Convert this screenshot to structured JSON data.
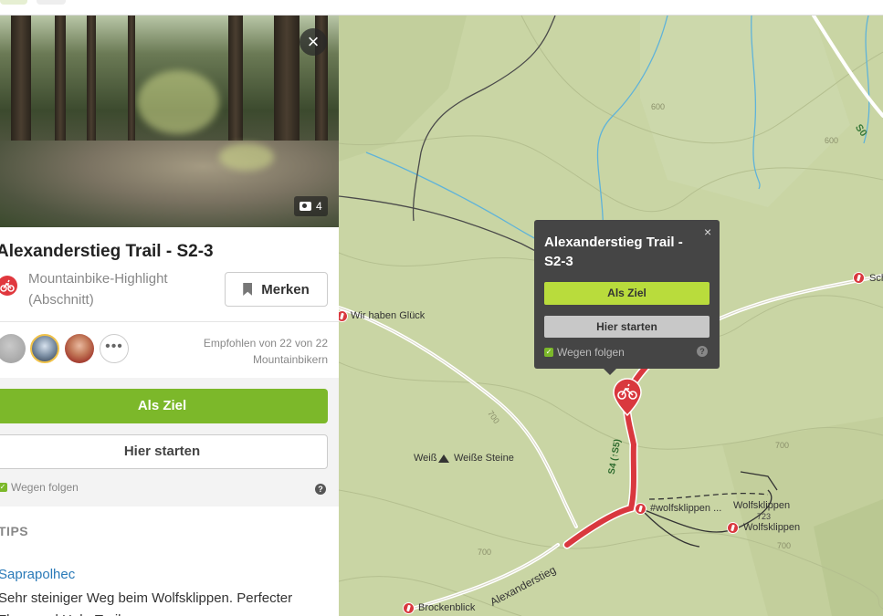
{
  "panel": {
    "photo_count": "4",
    "title": "Alexanderstieg Trail - S2-3",
    "subtitle": "Mountainbike-Highlight (Abschnitt)",
    "merken_label": "Merken",
    "recommended": "Empfohlen von 22 von 22 Mountainbikern",
    "more_label": "•••",
    "ziel_label": "Als Ziel",
    "start_label": "Hier starten",
    "follow_label": "Wegen folgen",
    "help_label": "?",
    "close_label": "×",
    "tips_heading": "TIPS",
    "tip": {
      "author": "Saprapolhec",
      "text": "Sehr steiniger Weg beim Wolfsklippen. Perfecter Flow- und Hole-Trail."
    }
  },
  "popup": {
    "title": "Alexanderstieg Trail - S2-3",
    "close_label": "×",
    "ziel_label": "Als Ziel",
    "start_label": "Hier starten",
    "follow_label": "Wegen folgen",
    "help_label": "?"
  },
  "map": {
    "labels": {
      "wir_haben_glueck": "Wir haben Glück",
      "weisse_steine_1": "Weiß",
      "weisse_steine_2": "Weiße Steine",
      "wolfsklippen_hash": "#wolfsklippen ...",
      "wolfsklippen_top": "Wolfsklippen",
      "wolfsklippen_bottom": "Wolfsklippen",
      "brockenblick": "Brockenblick",
      "alexanderstieg": "Alexanderstieg",
      "sch": "Sch",
      "s4": "S4 (↑S5)",
      "s0": "S0"
    },
    "contours": {
      "c600a": "600",
      "c600b": "600",
      "c700a": "700",
      "c700b": "700",
      "c700c": "700",
      "c700d": "700",
      "c723": "723"
    }
  },
  "colors": {
    "accent_green": "#7cb82a",
    "popup_green": "#b9dc3c",
    "route_red": "#d9383e",
    "map_green": "#c9d5a4"
  }
}
